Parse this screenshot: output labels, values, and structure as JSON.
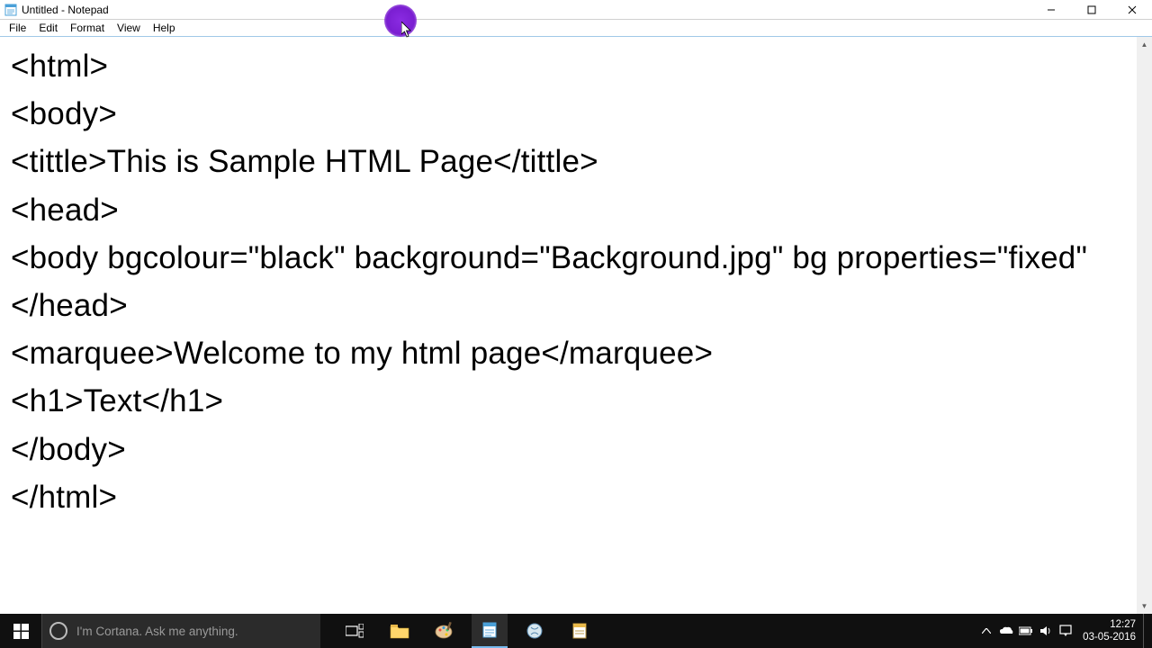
{
  "window": {
    "title": "Untitled - Notepad"
  },
  "menu": {
    "file": "File",
    "edit": "Edit",
    "format": "Format",
    "view": "View",
    "help": "Help"
  },
  "editor": {
    "content": "<html>\n<body>\n<tittle>This is Sample HTML Page</tittle>\n<head>\n<body bgcolour=\"black\" background=\"Background.jpg\" bg properties=\"fixed\"\n</head>\n<marquee>Welcome to my html page</marquee>\n<h1>Text</h1>\n</body>\n</html>"
  },
  "taskbar": {
    "cortana_placeholder": "I'm Cortana. Ask me anything."
  },
  "tray": {
    "time": "12:27",
    "date": "03-05-2016"
  }
}
